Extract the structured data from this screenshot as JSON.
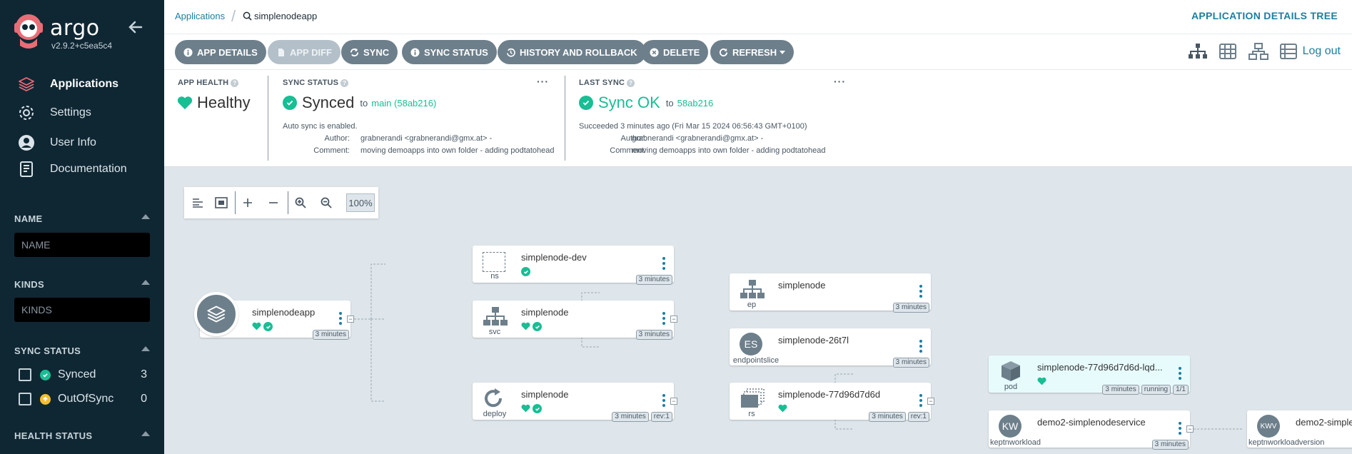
{
  "app": {
    "name": "argo",
    "version": "v2.9.2+c5ea5c4"
  },
  "nav": [
    {
      "label": "Applications",
      "icon": "stack-icon"
    },
    {
      "label": "Settings",
      "icon": "gear-icon"
    },
    {
      "label": "User Info",
      "icon": "user-icon"
    },
    {
      "label": "Documentation",
      "icon": "book-icon"
    }
  ],
  "filters": {
    "name": {
      "title": "NAME",
      "placeholder": "NAME"
    },
    "kinds": {
      "title": "KINDS",
      "placeholder": "KINDS"
    },
    "sync_status": {
      "title": "SYNC STATUS",
      "items": [
        {
          "label": "Synced",
          "count": "3",
          "color": "#18be94"
        },
        {
          "label": "OutOfSync",
          "count": "0",
          "color": "#f4c030"
        }
      ]
    },
    "health_status": {
      "title": "HEALTH STATUS"
    }
  },
  "breadcrumb": {
    "root": "Applications",
    "current": "simplenodeapp"
  },
  "view_title": "APPLICATION DETAILS TREE",
  "toolbar": {
    "app_details": "APP DETAILS",
    "app_diff": "APP DIFF",
    "sync": "SYNC",
    "sync_status": "SYNC STATUS",
    "history": "HISTORY AND ROLLBACK",
    "delete": "DELETE",
    "refresh": "REFRESH",
    "logout": "Log out"
  },
  "status": {
    "health": {
      "label": "APP HEALTH",
      "value": "Healthy"
    },
    "sync": {
      "label": "SYNC STATUS",
      "value": "Synced",
      "to": "to",
      "target": "main (58ab216)",
      "auto": "Auto sync is enabled.",
      "author_label": "Author:",
      "author": "grabnerandi <grabnerandi@gmx.at> -",
      "comment_label": "Comment:",
      "comment": "moving demoapps into own folder - adding podtatohead"
    },
    "last_sync": {
      "label": "LAST SYNC",
      "value": "Sync OK",
      "to": "to",
      "target": "58ab216",
      "succeeded": "Succeeded 3 minutes ago (Fri Mar 15 2024 06:56:43 GMT+0100)",
      "author_label": "Author:",
      "author": "grabnerandi <grabnerandi@gmx.at> -",
      "comment_label": "Comment:",
      "comment": "moving demoapps into own folder - adding podtatohead"
    }
  },
  "zoom": {
    "level": "100%"
  },
  "tree": {
    "app": {
      "name": "simplenodeapp",
      "age": "3 minutes"
    },
    "ns": {
      "name": "simplenode-dev",
      "kind": "ns",
      "age": "3 minutes"
    },
    "svc": {
      "name": "simplenode",
      "kind": "svc",
      "age": "3 minutes"
    },
    "deploy": {
      "name": "simplenode",
      "kind": "deploy",
      "age": "3 minutes",
      "rev": "rev:1"
    },
    "ep": {
      "name": "simplenode",
      "kind": "ep",
      "age": "3 minutes"
    },
    "eps": {
      "name": "simplenode-26t7l",
      "kind": "endpointslice",
      "badge": "ES",
      "age": "3 minutes"
    },
    "rs": {
      "name": "simplenode-77d96d7d6d",
      "kind": "rs",
      "age": "3 minutes",
      "rev": "rev:1"
    },
    "pod": {
      "name": "simplenode-77d96d7d6d-lqd...",
      "kind": "pod",
      "age": "3 minutes",
      "state": "running",
      "ready": "1/1"
    },
    "kw": {
      "name": "demo2-simplenodeservice",
      "kind": "keptnworkload",
      "badge": "KW",
      "age": "3 minutes"
    },
    "kwv": {
      "name": "demo2-simple",
      "kind": "keptnworkloadversion",
      "badge": "KWV"
    }
  }
}
